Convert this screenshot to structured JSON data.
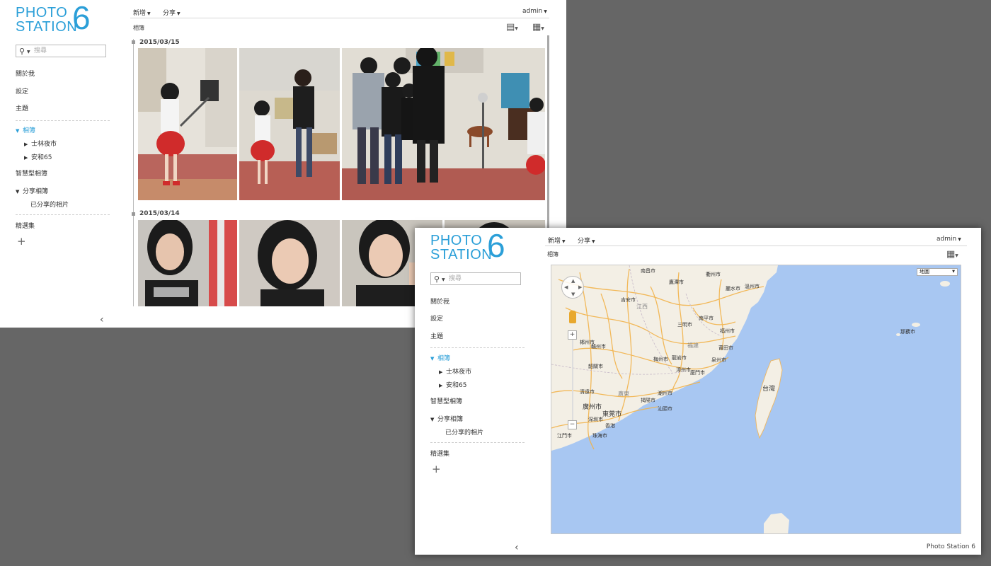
{
  "logo": {
    "line1": "PHOTO",
    "line2": "STATION",
    "version": "6"
  },
  "search": {
    "placeholder": "搜尋"
  },
  "sidebar": {
    "about": "關於我",
    "settings": "設定",
    "theme": "主題",
    "albums": "相簿",
    "album_items": [
      "士林夜市",
      "安和65"
    ],
    "smart_albums": "智慧型相簿",
    "shared_albums": "分享相簿",
    "shared_photos": "已分享的相片",
    "featured": "精選集",
    "add": "+",
    "collapse": "‹"
  },
  "toolbar": {
    "new": "新增",
    "share": "分享",
    "user": "admin"
  },
  "breadcrumb": "相簿",
  "timeline": [
    {
      "date": "2015/03/15",
      "photos": 3
    },
    {
      "date": "2015/03/14",
      "photos": 4
    }
  ],
  "map": {
    "type_select": "地圖",
    "labels": {
      "nanchang": "南昌市",
      "yingtan": "鷹潭市",
      "quzhou": "衢州市",
      "lishui": "麗水市",
      "wenzhou": "溫州市",
      "ji_an": "吉安市",
      "jiangxi": "江西",
      "sanming": "三明市",
      "nanping": "南平市",
      "fuzhou": "福州市",
      "fujian": "福建",
      "putian": "莆田市",
      "quanzhou": "泉州市",
      "ganzhou": "贛州市",
      "longyan": "龍岩市",
      "zhangzhou": "漳州市",
      "xiamen": "廈門市",
      "meizhou": "梅州市",
      "guangdong": "廣東",
      "qingyuan": "清遠市",
      "shaoguan": "韶關市",
      "chaozhou": "潮州市",
      "shantou": "汕頭市",
      "jieyang": "揭陽市",
      "guangzhou": "廣州市",
      "dongguan": "東莞市",
      "shenzhen": "深圳市",
      "hongkong": "香港",
      "zhuhai": "珠海市",
      "jiangmen": "江門市",
      "chenzhou": "郴州市",
      "taiwan": "台灣",
      "naha": "那覇市"
    }
  },
  "footer": "Photo Station 6",
  "colors": {
    "accent": "#2b9fd8",
    "sea": "#a8c7f2",
    "land": "#f3efe5",
    "roads": "#f2b34a",
    "background": "#666666"
  }
}
